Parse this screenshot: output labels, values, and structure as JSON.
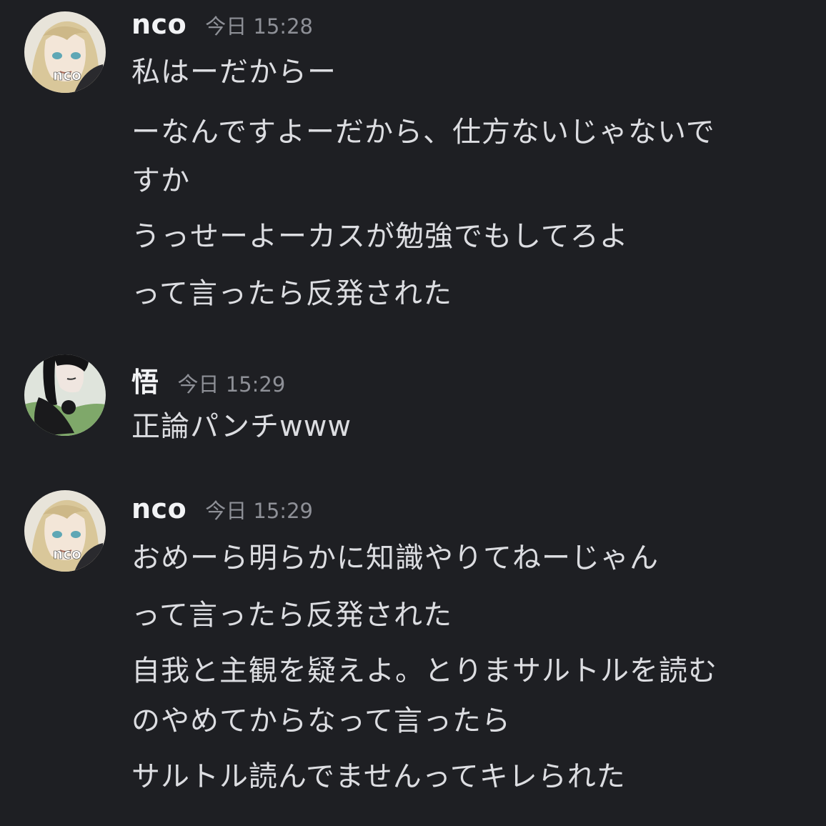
{
  "messages": [
    {
      "author": "nco",
      "avatar_icon": "anime-girl-avatar-icon",
      "avatar_text": "nco",
      "timestamp": "今日 15:28",
      "lines": [
        "私はーだからー",
        "ーなんですよーだから、仕方ないじゃないで",
        "すか",
        "うっせーよーカスが勉強でもしてろよ",
        "って言ったら反発された"
      ]
    },
    {
      "author": "悟",
      "avatar_icon": "sleeping-girl-avatar-icon",
      "timestamp": "今日 15:29",
      "lines": [
        "正論パンチwww"
      ]
    },
    {
      "author": "nco",
      "avatar_icon": "anime-girl-avatar-icon",
      "avatar_text": "nco",
      "timestamp": "今日 15:29",
      "lines": [
        "おめーら明らかに知識やりてねーじゃん",
        "って言ったら反発された",
        "自我と主観を疑えよ。とりまサルトルを読む",
        "のやめてからなって言ったら",
        "サルトル読んでませんってキレられた"
      ]
    }
  ],
  "colors": {
    "background": "#1e1f23",
    "username": "#f2f3f5",
    "timestamp": "#8e9097",
    "message_text": "#dcdde1"
  }
}
